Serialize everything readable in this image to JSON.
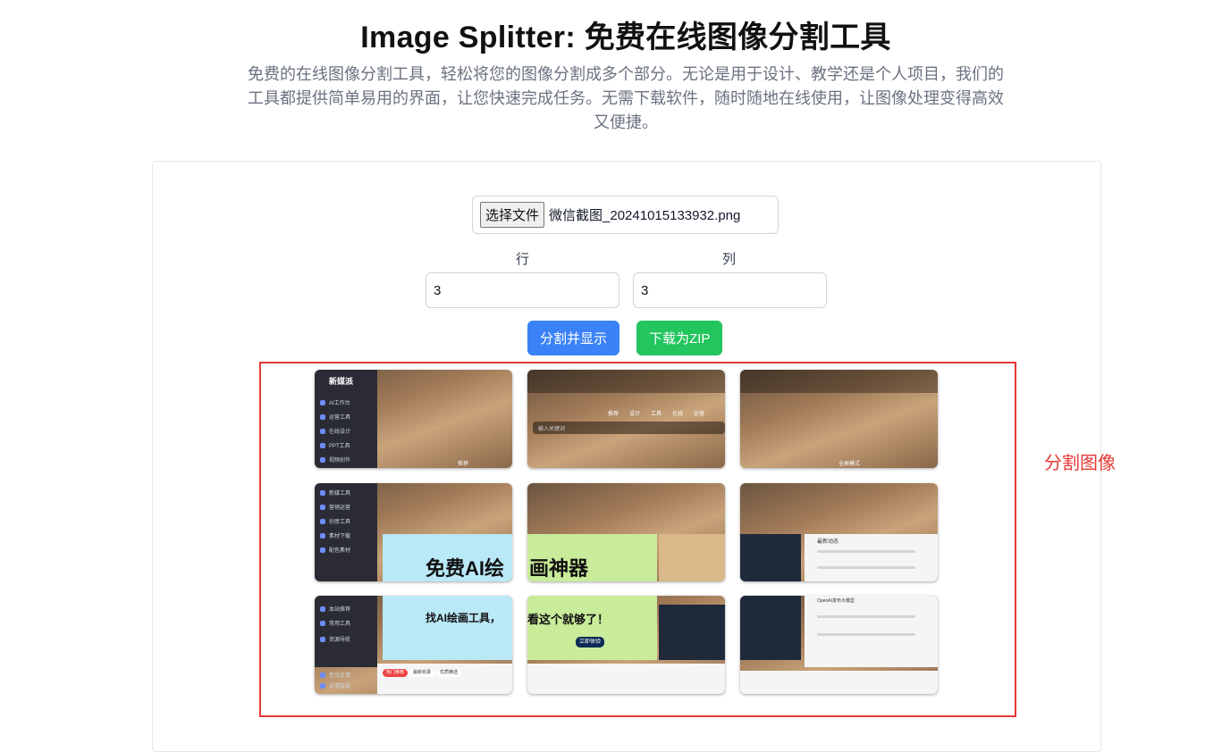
{
  "header": {
    "title": "Image Splitter: 免费在线图像分割工具",
    "subtitle": "免费的在线图像分割工具，轻松将您的图像分割成多个部分。无论是用于设计、教学还是个人项目，我们的工具都提供简单易用的界面，让您快速完成任务。无需下载软件，随时随地在线使用，让图像处理变得高效又便捷。"
  },
  "upload": {
    "button_label": "选择文件",
    "file_name": "微信截图_20241015133932.png"
  },
  "grid": {
    "rows_label": "行",
    "rows_value": "3",
    "cols_label": "列",
    "cols_value": "3"
  },
  "actions": {
    "split_label": "分割并显示",
    "zip_label": "下载为ZIP"
  },
  "annotation": {
    "label": "分割图像",
    "color": "#e53935"
  },
  "tiles": {
    "t1": {
      "brand": "新媒派",
      "items": [
        "AI工作台",
        "运营工具",
        "在线设计",
        "PPT工具",
        "视频创作"
      ],
      "footer": "推荐"
    },
    "t2": {
      "tabs": [
        "推荐",
        "设计",
        "工具",
        "在线",
        "运营"
      ],
      "search": "输入关键词"
    },
    "t3": {
      "footer": "全屏模式"
    },
    "t4": {
      "items": [
        "新媒工具",
        "营销运营",
        "创意工具",
        "素材下载",
        "配色素材"
      ],
      "banner": "免费AI绘"
    },
    "t5": {
      "banner": "画神器"
    },
    "t6": {
      "heading": "最新动态"
    },
    "t7": {
      "items": [
        "本站推荐",
        "常用工具",
        "资源导航",
        "意见反馈",
        "友情链接"
      ],
      "banner": "找AI绘画工具，",
      "tabs": [
        "热门推荐",
        "最新收录",
        "优质精选"
      ]
    },
    "t8": {
      "banner": "看这个就够了！",
      "cta": "立即体验"
    },
    "t9": {
      "heading": "OpenAI发布大模型"
    }
  },
  "colors": {
    "blue_button": "#3b82f6",
    "green_button": "#22c55e",
    "annotation_red": "#e53935"
  }
}
